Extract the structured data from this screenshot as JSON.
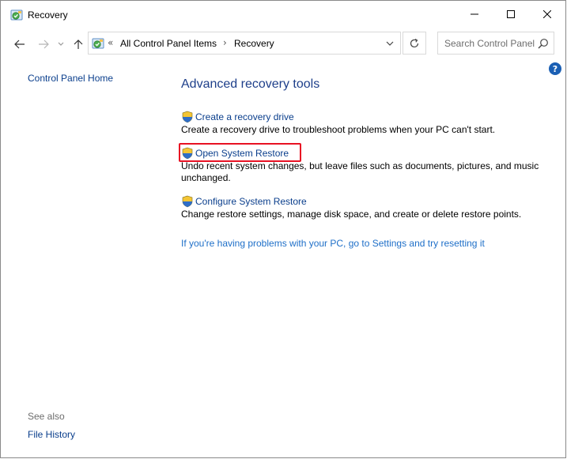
{
  "window": {
    "title": "Recovery",
    "icon": "recovery-control-panel-icon"
  },
  "titlebar_buttons": {
    "minimize": "minimize-icon",
    "maximize": "maximize-icon",
    "close": "close-icon"
  },
  "nav": {
    "back": "back-arrow-icon",
    "forward": "forward-arrow-icon",
    "recent": "chevron-down-icon",
    "up": "up-arrow-icon",
    "breadcrumbs": [
      "All Control Panel Items",
      "Recovery"
    ],
    "search_placeholder": "Search Control Panel"
  },
  "sidebar": {
    "home_link": "Control Panel Home",
    "see_also_label": "See also",
    "see_also_links": [
      "File History"
    ]
  },
  "main": {
    "heading": "Advanced recovery tools",
    "tasks": [
      {
        "label": "Create a recovery drive",
        "description": "Create a recovery drive to troubleshoot problems when your PC can't start."
      },
      {
        "label": "Open System Restore",
        "description": "Undo recent system changes, but leave files such as documents, pictures, and music unchanged.",
        "highlighted": true
      },
      {
        "label": "Configure System Restore",
        "description": "Change restore settings, manage disk space, and create or delete restore points."
      }
    ],
    "reset_link": "If you're having problems with your PC, go to Settings and try resetting it"
  },
  "colors": {
    "link": "#0a3e8c",
    "heading": "#1e3f8a",
    "reset_link": "#1e6fc8",
    "highlight_box": "#e81123",
    "help_icon": "#1a5fb4"
  }
}
